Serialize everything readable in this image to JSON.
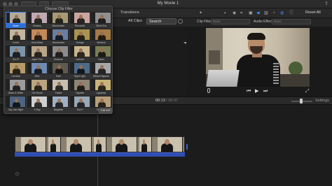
{
  "window": {
    "title": "My Movie 1"
  },
  "browser": {
    "tab_transitions": "Transitions",
    "all_clips": "All Clips",
    "search_value": "Search"
  },
  "viewer_toolbar": {
    "reset_all": "Reset All",
    "clip_filter_label": "Clip Filter:",
    "clip_filter_value": "None",
    "audio_effect_label": "Audio Effect:",
    "audio_effect_value": "None"
  },
  "timeline": {
    "current_time": "00:13",
    "separator": " / ",
    "duration": "00:37",
    "settings_label": "Settings"
  },
  "clip_filter_popover": {
    "title": "Choose Clip Filter",
    "cancel_label": "Cancel",
    "selected": "None",
    "filters": [
      {
        "label": "None",
        "tint": "#b3ab99"
      },
      {
        "label": "Dreamy",
        "tint": "#bfa9b3"
      },
      {
        "label": "Blockbuster",
        "tint": "#a59a76"
      },
      {
        "label": "Romantic",
        "tint": "#c9a6a0"
      },
      {
        "label": "Silent Era",
        "tint": "#8f8f8f"
      },
      {
        "label": "Comic",
        "tint": "#c2b8a0"
      },
      {
        "label": "Heat Wave",
        "tint": "#c48a5a"
      },
      {
        "label": "Blockbuster",
        "tint": "#6a7da0"
      },
      {
        "label": "Vintage",
        "tint": "#a9934f"
      },
      {
        "label": "Western",
        "tint": "#a57a45"
      },
      {
        "label": "Sci-Fi",
        "tint": "#7c94a7"
      },
      {
        "label": "Aged Film",
        "tint": "#b7a68a"
      },
      {
        "label": "Duotone",
        "tint": "#8c8c8c"
      },
      {
        "label": "Cartoon",
        "tint": "#c8b58e"
      },
      {
        "label": "Camo",
        "tint": "#7a7e55"
      },
      {
        "label": "Carnival",
        "tint": "#b59b6a"
      },
      {
        "label": "Blue",
        "tint": "#6f8bb3"
      },
      {
        "label": "Dark",
        "tint": "#5f5a50"
      },
      {
        "label": "Night Light",
        "tint": "#4d6b8a"
      },
      {
        "label": "Bleach Bypass",
        "tint": "#a7a7a7"
      },
      {
        "label": "Black & White",
        "tint": "#9b9b9b"
      },
      {
        "label": "Old World",
        "tint": "#b9a581"
      },
      {
        "label": "Faded",
        "tint": "#c7bfb0"
      },
      {
        "label": "Vignette",
        "tint": "#8e8474"
      },
      {
        "label": "Lightyear",
        "tint": "#cab37a"
      },
      {
        "label": "Day into Night",
        "tint": "#4f6480"
      },
      {
        "label": "X-Ray",
        "tint": "#cfcfcf"
      },
      {
        "label": "Negative",
        "tint": "#9fb0c2"
      },
      {
        "label": "Sci-Fi",
        "tint": "#9aa7b4"
      },
      {
        "label": "Duotone",
        "tint": "#b69f79"
      }
    ]
  },
  "colors": {
    "accent": "#3a82f7",
    "audio_track": "#2f4db1"
  }
}
